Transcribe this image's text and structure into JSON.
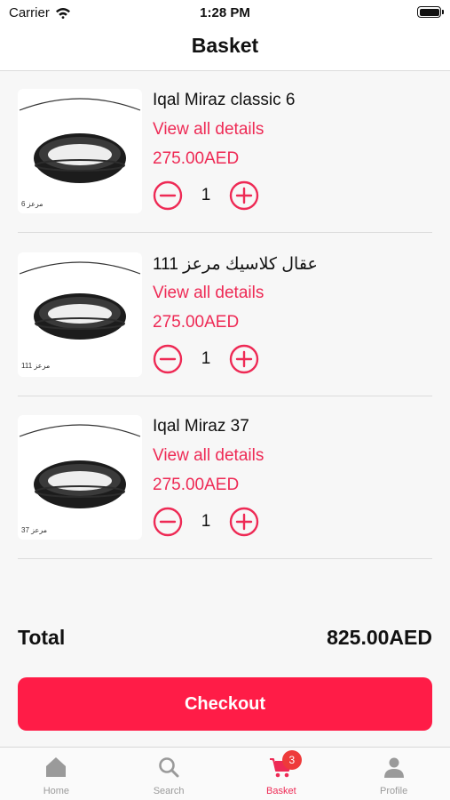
{
  "status_bar": {
    "carrier": "Carrier",
    "time": "1:28 PM"
  },
  "header": {
    "title": "Basket"
  },
  "items": [
    {
      "name": "Iqal Miraz classic 6",
      "details_link": "View all details",
      "price": "275.00AED",
      "quantity": "1",
      "image_caption": "مرعز 6"
    },
    {
      "name": "عقال كلاسيك مرعز 111",
      "details_link": "View all details",
      "price": "275.00AED",
      "quantity": "1",
      "image_caption": "مرعز 111"
    },
    {
      "name": "Iqal Miraz 37",
      "details_link": "View all details",
      "price": "275.00AED",
      "quantity": "1",
      "image_caption": "مرعز 37"
    }
  ],
  "summary": {
    "total_label": "Total",
    "total_value": "825.00AED"
  },
  "checkout": {
    "label": "Checkout"
  },
  "tabs": [
    {
      "label": "Home",
      "icon": "home-icon"
    },
    {
      "label": "Search",
      "icon": "search-icon"
    },
    {
      "label": "Basket",
      "icon": "cart-icon",
      "badge": "3",
      "active": true
    },
    {
      "label": "Profile",
      "icon": "profile-icon"
    }
  ],
  "colors": {
    "accent": "#ee2a55",
    "checkout_button": "#ff1c47",
    "badge": "#ee3a3a"
  }
}
